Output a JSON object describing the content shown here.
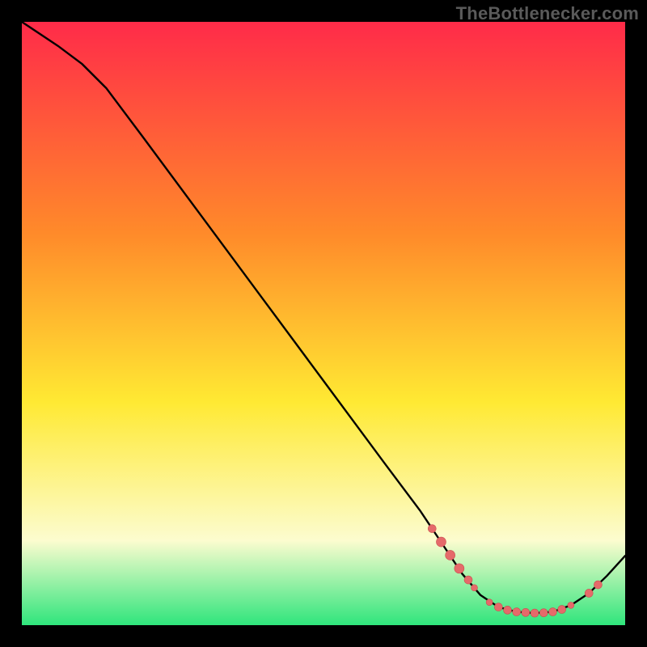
{
  "attribution": "TheBottlenecker.com",
  "colors": {
    "frame": "#000000",
    "gradient_top": "#ff2b49",
    "gradient_mid_upper": "#ff8a2a",
    "gradient_mid": "#ffe933",
    "gradient_lower": "#fcfccf",
    "gradient_bottom": "#2fe57c",
    "curve": "#000000",
    "dot_fill": "#e56a6a",
    "dot_stroke": "#c94f4f",
    "attribution_text": "#5a5a5a"
  },
  "chart_data": {
    "type": "line",
    "title": "",
    "xlabel": "",
    "ylabel": "",
    "xlim": [
      0,
      100
    ],
    "ylim": [
      0,
      100
    ],
    "grid": false,
    "legend": false,
    "curve": [
      {
        "x": 0,
        "y": 100
      },
      {
        "x": 6,
        "y": 96
      },
      {
        "x": 10,
        "y": 93
      },
      {
        "x": 14,
        "y": 89
      },
      {
        "x": 20,
        "y": 81
      },
      {
        "x": 30,
        "y": 67.5
      },
      {
        "x": 40,
        "y": 54
      },
      {
        "x": 50,
        "y": 40.5
      },
      {
        "x": 60,
        "y": 27
      },
      {
        "x": 66,
        "y": 19
      },
      {
        "x": 70,
        "y": 13
      },
      {
        "x": 73,
        "y": 8.5
      },
      {
        "x": 76,
        "y": 5
      },
      {
        "x": 79,
        "y": 3
      },
      {
        "x": 82,
        "y": 2.2
      },
      {
        "x": 85,
        "y": 2
      },
      {
        "x": 88,
        "y": 2.2
      },
      {
        "x": 91,
        "y": 3.3
      },
      {
        "x": 94,
        "y": 5.3
      },
      {
        "x": 97,
        "y": 8.2
      },
      {
        "x": 100,
        "y": 11.5
      }
    ],
    "highlight_points": [
      {
        "x": 68.0,
        "y": 16.0,
        "r": 5
      },
      {
        "x": 69.5,
        "y": 13.8,
        "r": 6
      },
      {
        "x": 71.0,
        "y": 11.6,
        "r": 6
      },
      {
        "x": 72.5,
        "y": 9.4,
        "r": 6
      },
      {
        "x": 74.0,
        "y": 7.5,
        "r": 5
      },
      {
        "x": 75.0,
        "y": 6.2,
        "r": 4
      },
      {
        "x": 77.5,
        "y": 3.8,
        "r": 4
      },
      {
        "x": 79.0,
        "y": 3.0,
        "r": 5
      },
      {
        "x": 80.5,
        "y": 2.5,
        "r": 5
      },
      {
        "x": 82.0,
        "y": 2.2,
        "r": 5
      },
      {
        "x": 83.5,
        "y": 2.1,
        "r": 5
      },
      {
        "x": 85.0,
        "y": 2.0,
        "r": 5
      },
      {
        "x": 86.5,
        "y": 2.05,
        "r": 5
      },
      {
        "x": 88.0,
        "y": 2.2,
        "r": 5
      },
      {
        "x": 89.5,
        "y": 2.6,
        "r": 5
      },
      {
        "x": 91.0,
        "y": 3.3,
        "r": 4
      },
      {
        "x": 94.0,
        "y": 5.3,
        "r": 5
      },
      {
        "x": 95.5,
        "y": 6.7,
        "r": 5
      }
    ]
  }
}
